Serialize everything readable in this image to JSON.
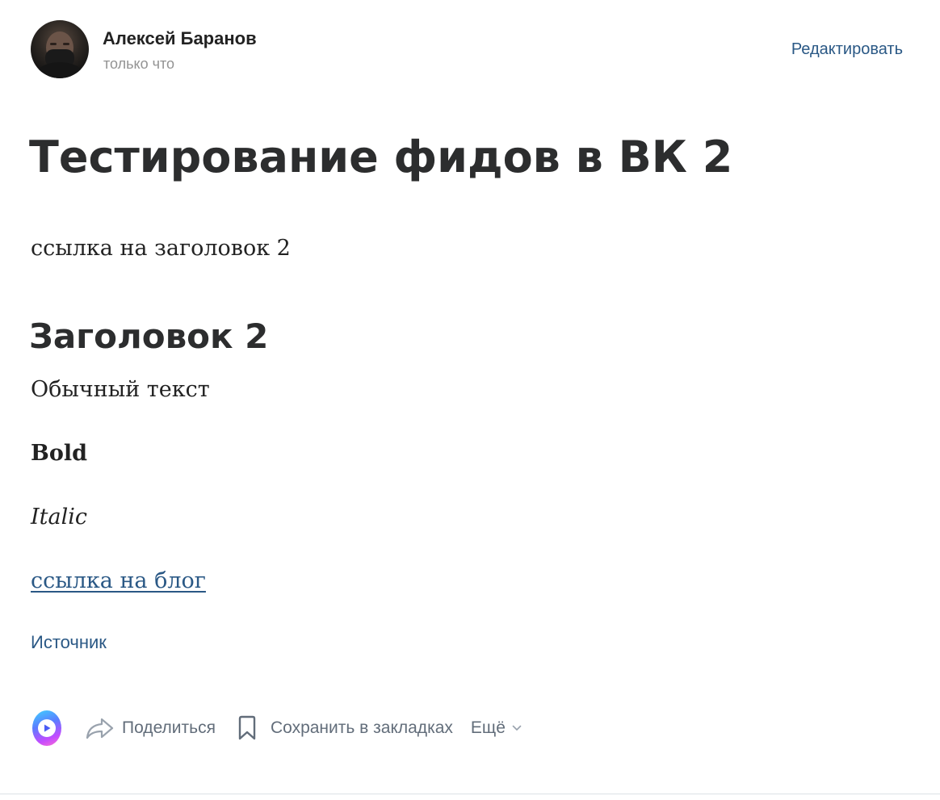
{
  "author": {
    "name": "Алексей Баранов",
    "time": "только что"
  },
  "header": {
    "edit_label": "Редактировать"
  },
  "article": {
    "title": "Тестирование фидов в ВК 2",
    "anchor_link_text": "ссылка на заголовок 2",
    "heading2": "Заголовок 2",
    "plain_text": "Обычный текст",
    "bold_text": "Bold",
    "italic_text": "Italic",
    "blog_link_text": "ссылка на блог",
    "source_label": "Источник"
  },
  "actions": {
    "share_label": "Поделиться",
    "bookmark_label": "Сохранить в закладках",
    "more_label": "Ещё"
  },
  "icons": {
    "avatar": "user-avatar-photo",
    "play": "play-icon",
    "share": "share-arrow-icon",
    "bookmark": "bookmark-icon",
    "more": "chevron-down-icon"
  },
  "colors": {
    "link": "#2a5885",
    "text": "#2c2d2e",
    "muted": "#939393",
    "action": "#626d7a"
  }
}
